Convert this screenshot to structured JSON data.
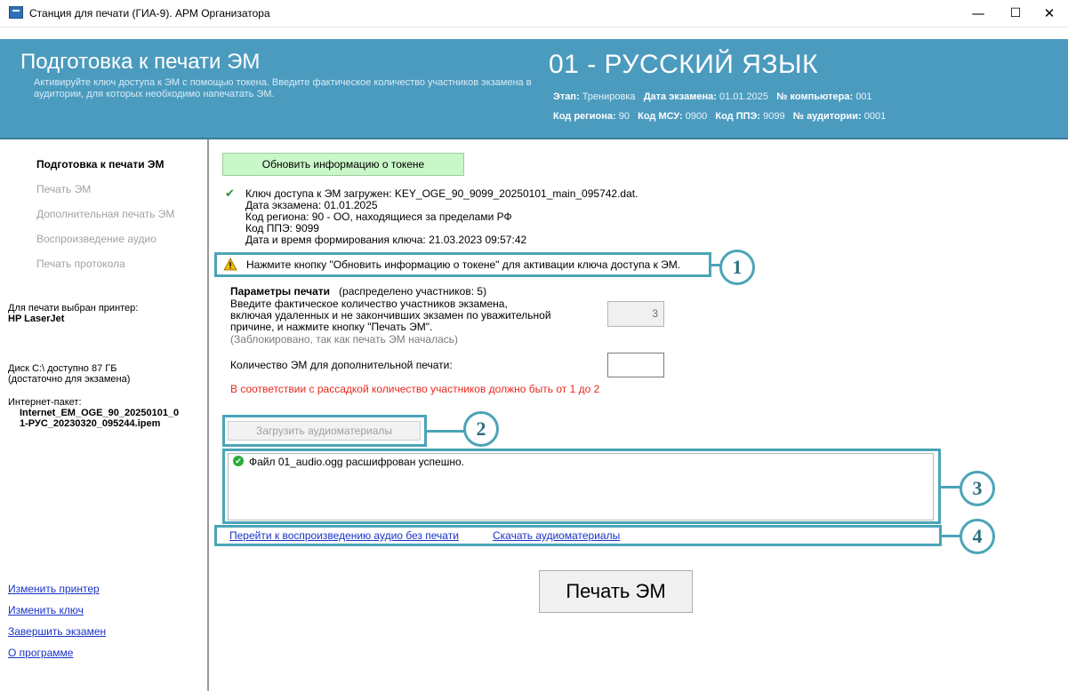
{
  "window": {
    "title": "Станция для печати (ГИА-9). АРМ Организатора",
    "minimize": "—",
    "maximize": "☐",
    "close": "✕"
  },
  "header": {
    "title": "Подготовка к печати ЭМ",
    "description": "Активируйте ключ доступа к ЭМ с помощью токена. Введите фактическое количество участников экзамена в аудитории, для которых необходимо напечатать ЭМ.",
    "subject": "01 - РУССКИЙ ЯЗЫК",
    "meta": {
      "stage_label": "Этап:",
      "stage": "Тренировка",
      "exam_date_label": "Дата экзамена:",
      "exam_date": "01.01.2025",
      "computer_label": "№ компьютера:",
      "computer": "001",
      "region_label": "Код региона:",
      "region": "90",
      "msu_label": "Код МСУ:",
      "msu": "0900",
      "ppe_label": "Код ППЭ:",
      "ppe": "9099",
      "room_label": "№ аудитории:",
      "room": "0001"
    }
  },
  "sidebar": {
    "nav": [
      {
        "label": "Подготовка к печати ЭМ",
        "active": true
      },
      {
        "label": "Печать ЭМ",
        "active": false
      },
      {
        "label": "Дополнительная печать ЭМ",
        "active": false
      },
      {
        "label": "Воспроизведение аудио",
        "active": false
      },
      {
        "label": "Печать протокола",
        "active": false
      }
    ],
    "printer_label": "Для печати выбран принтер:",
    "printer": "HP LaserJet",
    "disk_line1": "Диск C:\\ доступно 87 ГБ",
    "disk_line2": "(достаточно для экзамена)",
    "package_label": "Интернет-пакет:",
    "package_line1": "Internet_EM_OGE_90_20250101_0",
    "package_line2": "1-РУС_20230320_095244.ipem",
    "links": [
      "Изменить принтер",
      "Изменить ключ",
      "Завершить экзамен",
      "О программе"
    ]
  },
  "main": {
    "refresh_token_button": "Обновить информацию о токене",
    "key_info": [
      "Ключ доступа к ЭМ загружен: KEY_OGE_90_9099_20250101_main_095742.dat.",
      "Дата экзамена: 01.01.2025",
      "Код региона: 90 - ОО, находящиеся за пределами РФ",
      "Код ППЭ: 9099",
      "Дата и время формирования ключа: 21.03.2023 09:57:42"
    ],
    "warning": "Нажмите кнопку \"Обновить информацию о токене\" для активации ключа доступа к ЭМ.",
    "params_title": "Параметры печати",
    "params_distributed": "(распределено участников: 5)",
    "participants_prompt": [
      "Введите фактическое количество участников экзамена,",
      "включая удаленных и не закончивших экзамен по уважительной",
      "причине, и нажмите кнопку \"Печать ЭМ\"."
    ],
    "locked_note": "(Заблокировано, так как печать ЭМ началась)",
    "participants_value": "3",
    "extra_print_label": "Количество ЭМ для дополнительной печати:",
    "extra_print_value": "",
    "error_text": "В соответствии с рассадкой количество участников должно быть от 1 до 2",
    "load_audio_button": "Загрузить аудиоматериалы",
    "audio_log": "Файл 01_audio.ogg расшифрован успешно.",
    "link_play_audio": "Перейти к воспроизведению аудио без печати",
    "link_download_audio": "Скачать аудиоматериалы",
    "print_button": "Печать ЭМ"
  },
  "callouts": [
    "1",
    "2",
    "3",
    "4"
  ],
  "colors": {
    "header_bg": "#4b9bbf",
    "highlight": "#4ba4b8",
    "link": "#1a33c4",
    "error": "#e8281e",
    "refresh_bg": "#c9f7c9"
  }
}
